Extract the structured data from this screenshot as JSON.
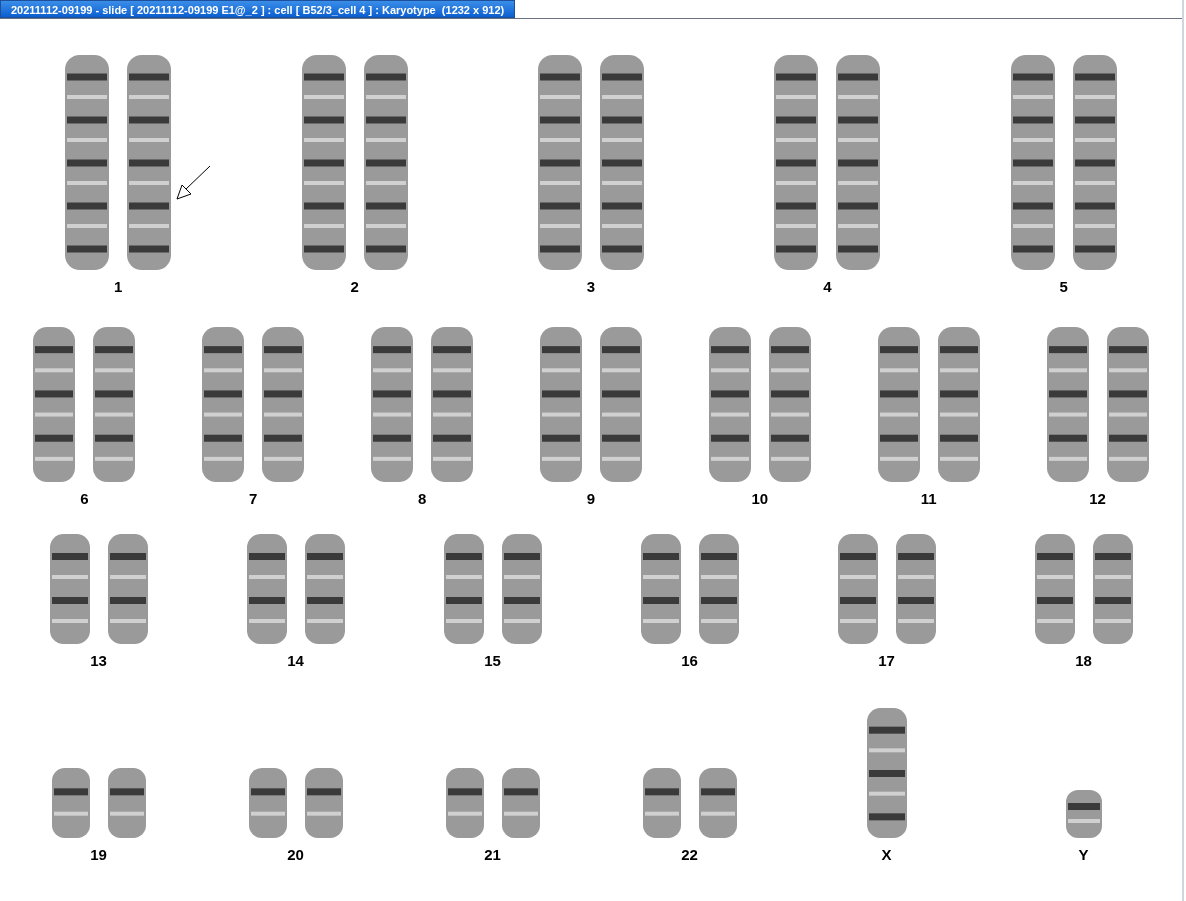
{
  "window": {
    "title": "20211112-09199 - slide [ 20211112-09199 E1@_2 ] : cell [ B52/3_cell 4 ] : Karyotype  (1232 x 912)"
  },
  "rows": [
    {
      "items": [
        {
          "label": "1",
          "kind": "pair",
          "marked": true
        },
        {
          "label": "2",
          "kind": "pair",
          "marked": false
        },
        {
          "label": "3",
          "kind": "pair",
          "marked": false
        },
        {
          "label": "4",
          "kind": "pair",
          "marked": false
        },
        {
          "label": "5",
          "kind": "pair",
          "marked": false
        }
      ]
    },
    {
      "items": [
        {
          "label": "6",
          "kind": "pair",
          "marked": false
        },
        {
          "label": "7",
          "kind": "pair",
          "marked": false
        },
        {
          "label": "8",
          "kind": "pair",
          "marked": false
        },
        {
          "label": "9",
          "kind": "pair",
          "marked": false
        },
        {
          "label": "10",
          "kind": "pair",
          "marked": false
        },
        {
          "label": "11",
          "kind": "pair",
          "marked": false
        },
        {
          "label": "12",
          "kind": "pair",
          "marked": false
        }
      ]
    },
    {
      "items": [
        {
          "label": "13",
          "kind": "pair",
          "marked": false
        },
        {
          "label": "14",
          "kind": "pair",
          "marked": false
        },
        {
          "label": "15",
          "kind": "pair",
          "marked": false
        },
        {
          "label": "16",
          "kind": "pair",
          "marked": false
        },
        {
          "label": "17",
          "kind": "pair",
          "marked": false
        },
        {
          "label": "18",
          "kind": "pair",
          "marked": false
        }
      ]
    },
    {
      "items": [
        {
          "label": "19",
          "kind": "pair",
          "marked": false
        },
        {
          "label": "20",
          "kind": "pair",
          "marked": false
        },
        {
          "label": "21",
          "kind": "pair",
          "marked": false
        },
        {
          "label": "22",
          "kind": "pair",
          "marked": false
        },
        {
          "label": "X",
          "kind": "single-tall",
          "marked": false
        },
        {
          "label": "Y",
          "kind": "single-short",
          "marked": false
        }
      ]
    }
  ]
}
